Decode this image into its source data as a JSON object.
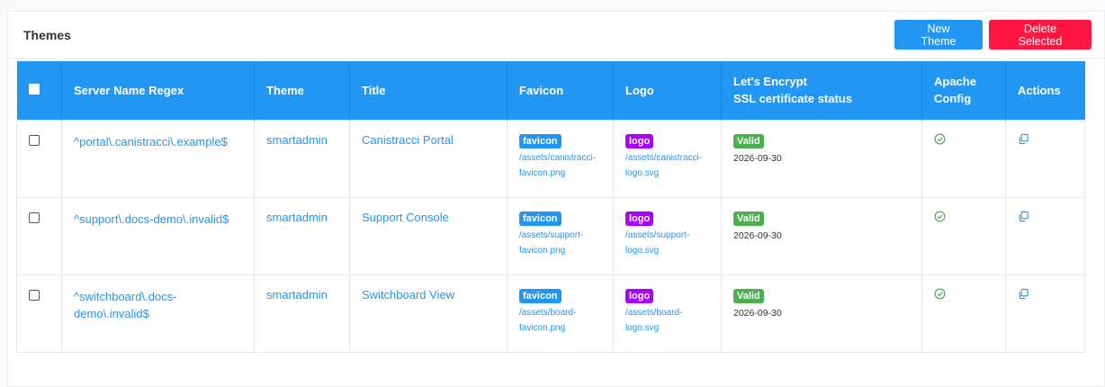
{
  "header": {
    "title": "Themes",
    "new_label": "New Theme",
    "delete_label": "Delete Selected"
  },
  "columns": [
    "Server Name Regex",
    "Theme",
    "Title",
    "Favicon",
    "Logo",
    "Let's Encrypt",
    "SSL certificate status",
    "Apache",
    "Config",
    "Actions"
  ],
  "rows": [
    {
      "regex": "^portal\\.canistracci\\.example$",
      "theme": "smartadmin",
      "title": "Canistracci Portal",
      "favicon_badge": "favicon",
      "favicon_path": "/assets/canistracci-favicon.png",
      "logo_badge": "logo",
      "logo_path": "/assets/canistracci-logo.svg",
      "ssl_status": "Valid",
      "ssl_date": "2026-09-30"
    },
    {
      "regex": "^support\\.docs-demo\\.invalid$",
      "theme": "smartadmin",
      "title": "Support Console",
      "favicon_badge": "favicon",
      "favicon_path": "/assets/support-favicon.png",
      "logo_badge": "logo",
      "logo_path": "/assets/support-logo.svg",
      "ssl_status": "Valid",
      "ssl_date": "2026-09-30"
    },
    {
      "regex": "^switchboard\\.docs-demo\\.invalid$",
      "theme": "smartadmin",
      "title": "Switchboard View",
      "favicon_badge": "favicon",
      "favicon_path": "/assets/board-favicon.png",
      "logo_badge": "logo",
      "logo_path": "/assets/board-logo.svg",
      "ssl_status": "Valid",
      "ssl_date": "2026-09-30"
    }
  ],
  "icons": {
    "apache_config": "check-circle-icon",
    "action": "copy-icon"
  },
  "colors": {
    "primary": "#2196f3",
    "danger": "#ff1744",
    "logo_badge": "#aa00ff",
    "valid_badge": "#4caf50"
  }
}
